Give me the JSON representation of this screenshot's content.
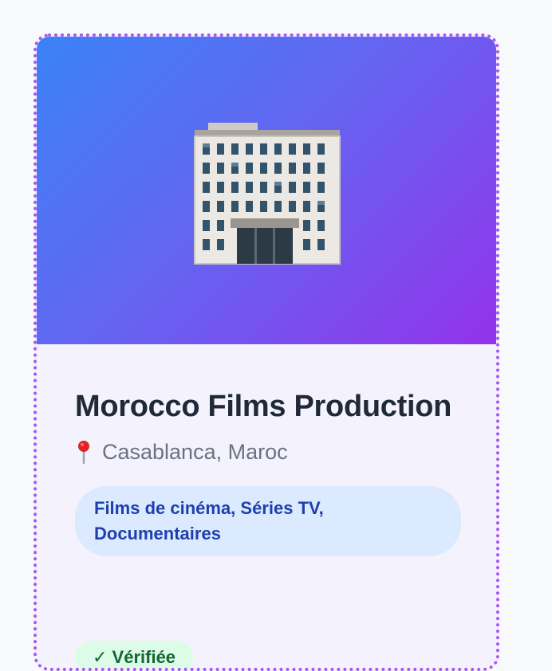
{
  "card": {
    "hero_icon": "office-building-icon",
    "title": "Morocco Films Production",
    "location_icon": "map-pin-icon",
    "location": "Casablanca, Maroc",
    "tag": "Films de cinéma, Séries TV, Documentaires",
    "badge": "✓ Vérifiée"
  },
  "colors": {
    "card_border": "#a855f7",
    "hero_gradient_start": "#3b82f6",
    "hero_gradient_end": "#9333ea",
    "tag_bg": "#dbeafe",
    "tag_text": "#1e40af",
    "badge_bg": "#dcfce7",
    "badge_text": "#166534"
  }
}
